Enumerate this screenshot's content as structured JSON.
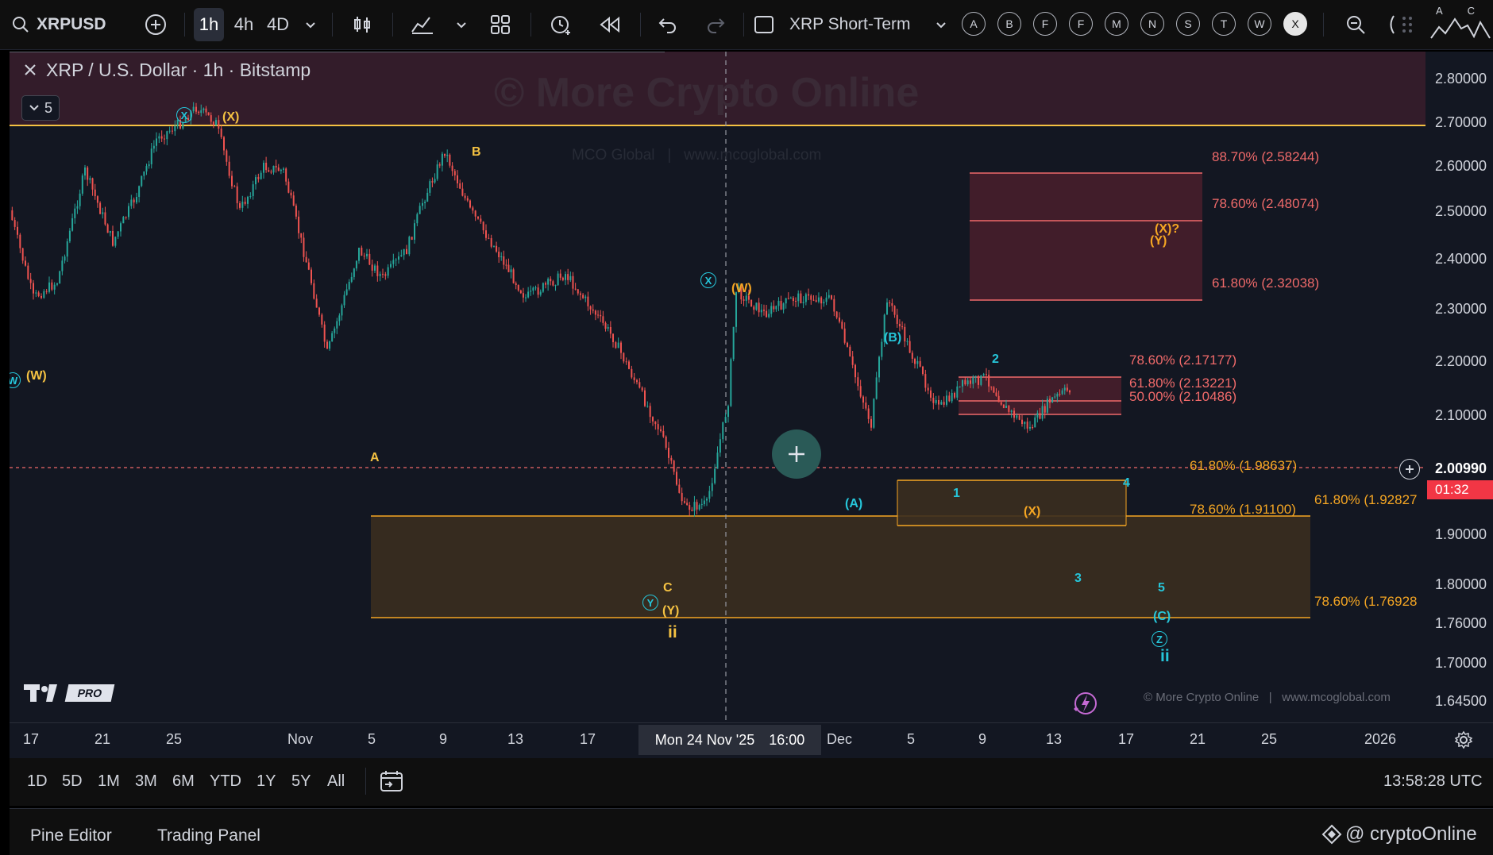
{
  "toolbar": {
    "symbol": "XRPUSD",
    "intervals": [
      "1h",
      "4h",
      "4D"
    ],
    "layout_name": "XRP Short-Term",
    "alphabet_buttons": [
      "A",
      "B",
      "F",
      "F",
      "M",
      "N",
      "S",
      "T",
      "W",
      "X"
    ],
    "partial_label": "A C"
  },
  "legend": {
    "title": "XRP / U.S. Dollar · 1h · Bitstamp",
    "collapse_count": "5"
  },
  "watermark": {
    "main": "© More Crypto Online",
    "sub": "MCO Global   |   www.mcoglobal.com",
    "footer": "© More Crypto Online   |   www.mcoglobal.com"
  },
  "price_axis": {
    "labels": [
      "2.80000",
      "2.70000",
      "2.60000",
      "2.50000",
      "2.40000",
      "2.30000",
      "2.20000",
      "2.10000",
      "2.00990",
      "1.90000",
      "1.80000",
      "1.76000",
      "1.70000",
      "1.64500"
    ],
    "current_price": "2.00990",
    "countdown": "01:32"
  },
  "time_axis": {
    "labels": [
      "17",
      "21",
      "25",
      "Nov",
      "5",
      "9",
      "13",
      "17",
      "Dec",
      "5",
      "9",
      "13",
      "17",
      "21",
      "25",
      "2026"
    ],
    "crosshair_label": "Mon 24 Nov '25",
    "crosshair_time": "16:00"
  },
  "fib_levels": {
    "upper_zone": [
      "88.70% (2.58244)",
      "78.60% (2.48074)",
      "61.80% (2.32038)"
    ],
    "mid_zone": [
      "78.60% (2.17177)",
      "61.80% (2.13221)",
      "50.00% (2.10486)"
    ],
    "current_zone": [
      "61.80% (1.98637)",
      "78.60% (1.91100)"
    ],
    "lower_zone": [
      "61.80% (1.92827",
      "78.60% (1.76928"
    ]
  },
  "wave_labels": {
    "yellow": [
      "(X)",
      "B",
      "(W)",
      "A",
      "C",
      "(Y)",
      "ii",
      "(W)",
      "(X)",
      "(X)?",
      "(Y)"
    ],
    "cyan": [
      "X",
      "X",
      "W",
      "(B)",
      "2",
      "(A)",
      "1",
      "4",
      "3",
      "5",
      "(C)",
      "Y",
      "Z",
      "ii"
    ]
  },
  "branding": {
    "pro": "PRO"
  },
  "range_buttons": [
    "1D",
    "5D",
    "1M",
    "3M",
    "6M",
    "YTD",
    "1Y",
    "5Y",
    "All"
  ],
  "clock": "13:58:28 UTC",
  "bottom_tabs": [
    "Pine Editor",
    "Trading Panel"
  ],
  "overlay_watermark": "@ cryptoOnline",
  "colors": {
    "background": "#131722",
    "candle_up": "#26a69a",
    "candle_down": "#ef5350",
    "fib_red": "#f06a6a",
    "fib_orange": "#f5a623",
    "wave_yellow": "#f5c242",
    "wave_cyan": "#26c6da"
  }
}
